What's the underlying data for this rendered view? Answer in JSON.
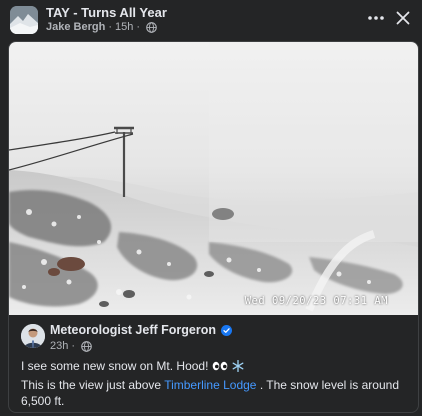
{
  "group": {
    "title": "TAY - Turns All Year",
    "author": "Jake Bergh",
    "age": "15h",
    "separator": "·"
  },
  "actions": {
    "more_icon": "more-horizontal-icon",
    "close_icon": "close-icon"
  },
  "shared_post": {
    "author": "Meteorologist Jeff Forgeron",
    "age": "23h",
    "separator": "·",
    "caption_line1": "I see some new snow on Mt. Hood!",
    "caption_line2_prefix": "This is the view just above",
    "link_text": "Timberline Lodge",
    "caption_line2_suffix": ". The snow level is around 6,500 ft.",
    "photo_timestamp": "Wed 09/20/23  07:31 AM"
  },
  "colors": {
    "background": "#242526",
    "text_primary": "#e4e6eb",
    "text_secondary": "#b0b3b8",
    "link": "#4599ff",
    "verified": "#1877f2"
  }
}
